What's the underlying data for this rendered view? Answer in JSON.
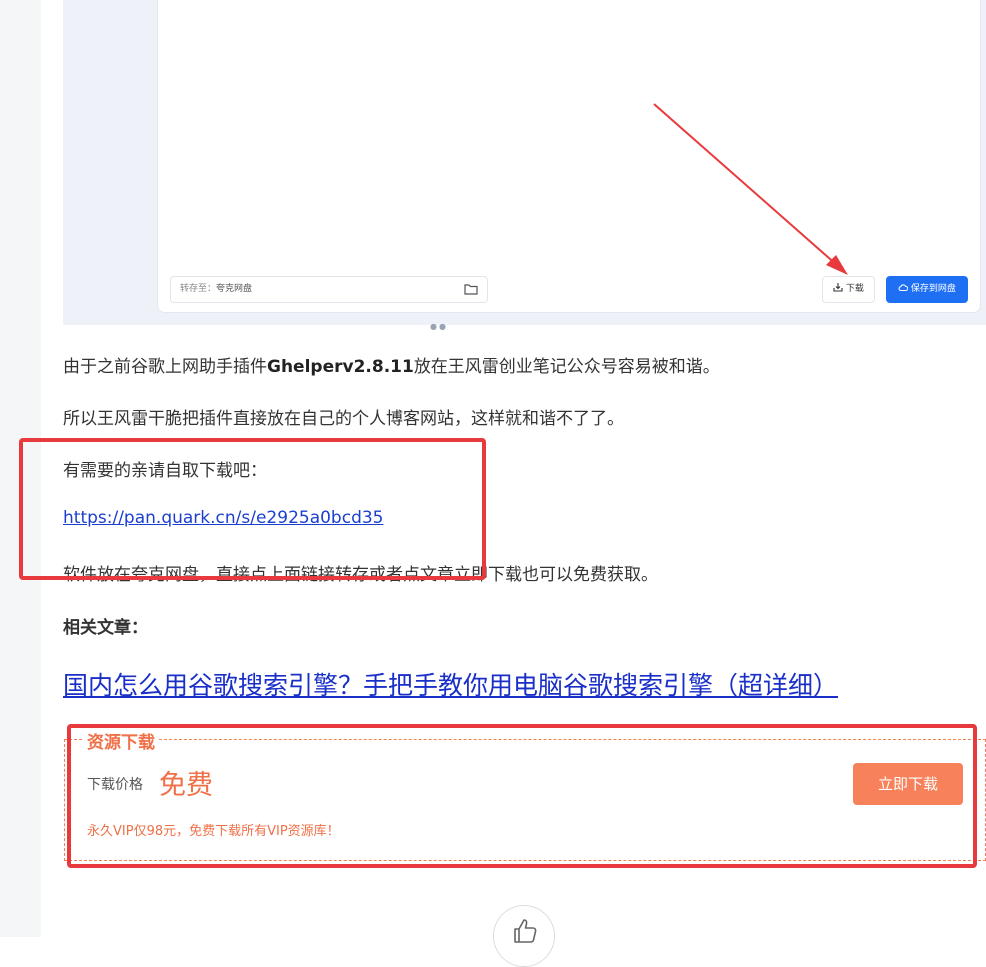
{
  "screenshot": {
    "save_to_label": "转存至：",
    "save_to_value": "夸克网盘",
    "download_label": "下载",
    "save_to_netdisk_label": "保存到网盘",
    "icons": [
      "folder-icon",
      "download-icon",
      "cloud-icon",
      "red-arrow-annotation"
    ]
  },
  "article": {
    "para1_prefix": "由于之前谷歌上网助手插件",
    "para1_bold": "Ghelperv2.8.11",
    "para1_suffix": "放在王风雷创业笔记公众号容易被和谐。",
    "para2": "所以王风雷干脆把插件直接放在自己的个人博客网站，这样就和谐不了了。",
    "para3": "有需要的亲请自取下载吧：",
    "link": "https://pan.quark.cn/s/e2925a0bcd35",
    "para4": "软件放在夸克网盘，直接点上面链接转存或者点文章立即下载也可以免费获取。",
    "related_title": "相关文章：",
    "related_link": "国内怎么用谷歌搜索引擎？手把手教你用电脑谷歌搜索引擎（超详细）"
  },
  "resource": {
    "title": "资源下载",
    "price_label": "下载价格",
    "price_value": "免费",
    "button": "立即下载",
    "vip_note": "永久VIP仅98元，免费下载所有VIP资源库！"
  },
  "colors": {
    "annotation_red": "#e8393c",
    "accent_orange": "#f07048",
    "button_orange": "#f7815a",
    "link_blue": "#1a3fcf",
    "netdisk_blue": "#1f6ff5"
  }
}
